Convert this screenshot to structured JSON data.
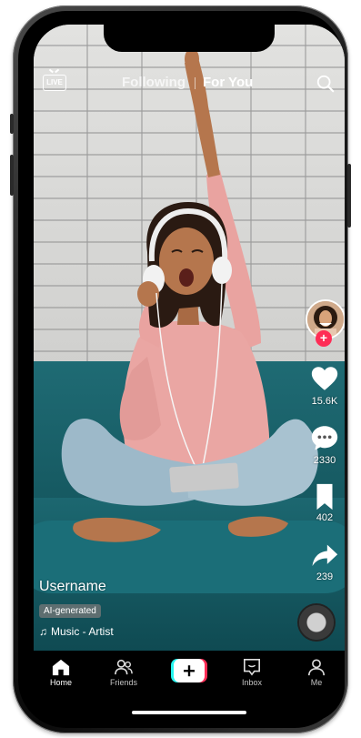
{
  "top_bar": {
    "live_label": "LIVE",
    "tabs": [
      {
        "label": "Following",
        "active": false
      },
      {
        "label": "For You",
        "active": true
      }
    ]
  },
  "actions": {
    "likes": "15.6K",
    "comments": "2330",
    "saves": "402",
    "shares": "239"
  },
  "video": {
    "username": "Username",
    "ai_badge": "AI-generated",
    "music": "Music - Artist"
  },
  "nav": {
    "home": "Home",
    "friends": "Friends",
    "inbox": "Inbox",
    "me": "Me"
  },
  "colors": {
    "accent_red": "#fe2c55",
    "accent_cyan": "#25f4ee"
  }
}
